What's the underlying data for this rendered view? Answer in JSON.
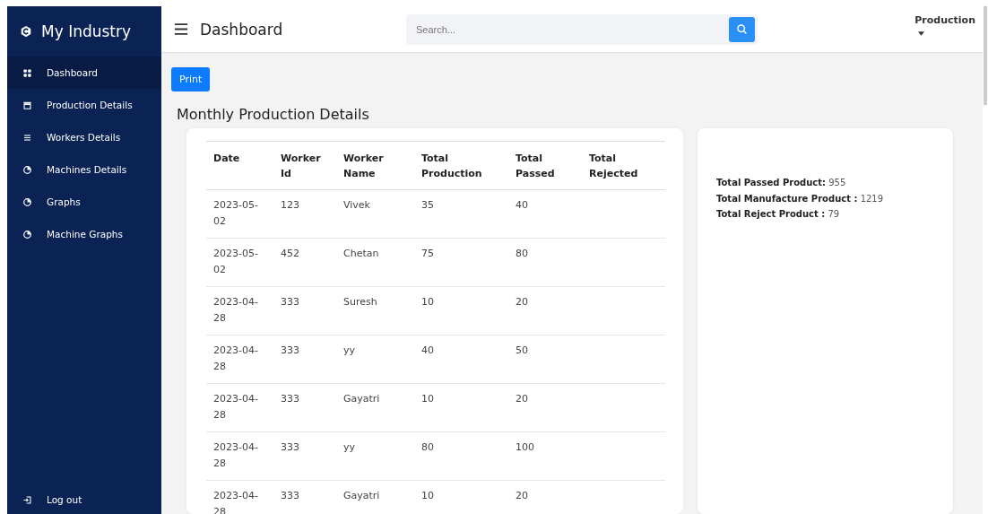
{
  "sidebar": {
    "brand": "My Industry",
    "items": [
      {
        "label": "Dashboard",
        "selected": true
      },
      {
        "label": "Production Details",
        "selected": false
      },
      {
        "label": "Workers Details",
        "selected": false
      },
      {
        "label": "Machines Details",
        "selected": false
      },
      {
        "label": "Graphs",
        "selected": false
      },
      {
        "label": "Machine Graphs",
        "selected": false
      }
    ],
    "logout": "Log out"
  },
  "header": {
    "title": "Dashboard",
    "search": {
      "placeholder": "Search..."
    },
    "user_menu": "Production"
  },
  "print_button": "Print",
  "page_title": "Monthly Production Details",
  "table": {
    "columns": [
      "Date",
      "Worker Id",
      "Worker Name",
      "Total Production",
      "Total Passed",
      "Total Rejected"
    ],
    "rows": [
      [
        "2023-05-02",
        "123",
        "Vivek",
        "35",
        "40"
      ],
      [
        "2023-05-02",
        "452",
        "Chetan",
        "75",
        "80"
      ],
      [
        "2023-04-28",
        "333",
        "Suresh",
        "10",
        "20"
      ],
      [
        "2023-04-28",
        "333",
        "yy",
        "40",
        "50"
      ],
      [
        "2023-04-28",
        "333",
        "Gayatri",
        "10",
        "20"
      ],
      [
        "2023-04-28",
        "333",
        "yy",
        "80",
        "100"
      ],
      [
        "2023-04-28",
        "333",
        "Gayatri",
        "10",
        "20"
      ]
    ]
  },
  "summary": [
    "**Total Passed Product:** 955",
    "**Total Manufacture Product :** 1219",
    "**Total Reject Product :** 79"
  ]
}
